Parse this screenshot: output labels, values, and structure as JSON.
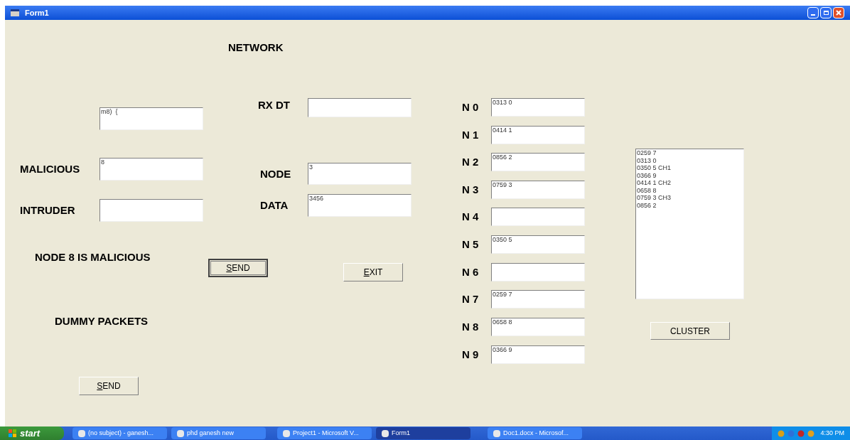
{
  "window": {
    "title": "Form1"
  },
  "form": {
    "heading": "NETWORK",
    "detection_fields": [
      {
        "value": "m8)  {"
      },
      {
        "label": "MALICIOUS",
        "value": "8"
      },
      {
        "label": "INTRUDER"
      }
    ],
    "transfer_fields": [
      {
        "label": "RX DT"
      },
      {
        "label": "NODE",
        "value": "3"
      },
      {
        "label": "DATA",
        "value": "3456"
      }
    ],
    "status_texts": [
      "NODE 8 IS MALICIOUS",
      "DUMMY PACKETS"
    ],
    "buttons": [
      {
        "label": "SEND",
        "access_key_underlined": true,
        "default": true
      },
      {
        "label": "EXIT",
        "access_key_underlined": true,
        "default": false
      },
      {
        "label": "SEND",
        "access_key_underlined": true,
        "default": false
      },
      {
        "label": "CLUSTER",
        "access_key_underlined": false,
        "default": false
      }
    ],
    "nodes": [
      {
        "label": "N 0",
        "value": "0313 0"
      },
      {
        "label": "N 1",
        "value": "0414 1"
      },
      {
        "label": "N 2",
        "value": "0856 2"
      },
      {
        "label": "N 3",
        "value": "0759 3"
      },
      {
        "label": "N 4"
      },
      {
        "label": "N 5",
        "value": "0350 5"
      },
      {
        "label": "N 6"
      },
      {
        "label": "N 7",
        "value": "0259 7"
      },
      {
        "label": "N 8",
        "value": "0658 8"
      },
      {
        "label": "N 9",
        "value": "0366 9"
      }
    ],
    "list": [
      "0259 7",
      "0313 0",
      "0350 5 CH1",
      "0366 9",
      "0414 1 CH2",
      "0658 8",
      "0759 3 CH3",
      "0856 2"
    ]
  },
  "taskbar": {
    "start": "start",
    "items": [
      {
        "label": "(no subject) - ganesh...",
        "selected": false
      },
      {
        "label": "phd ganesh new",
        "selected": false
      },
      {
        "label": "Project1 - Microsoft V...",
        "selected": false
      },
      {
        "label": "Form1",
        "selected": true
      },
      {
        "label": "Doc1.docx - Microsof...",
        "selected": false
      }
    ],
    "clock": "4:30 PM"
  }
}
